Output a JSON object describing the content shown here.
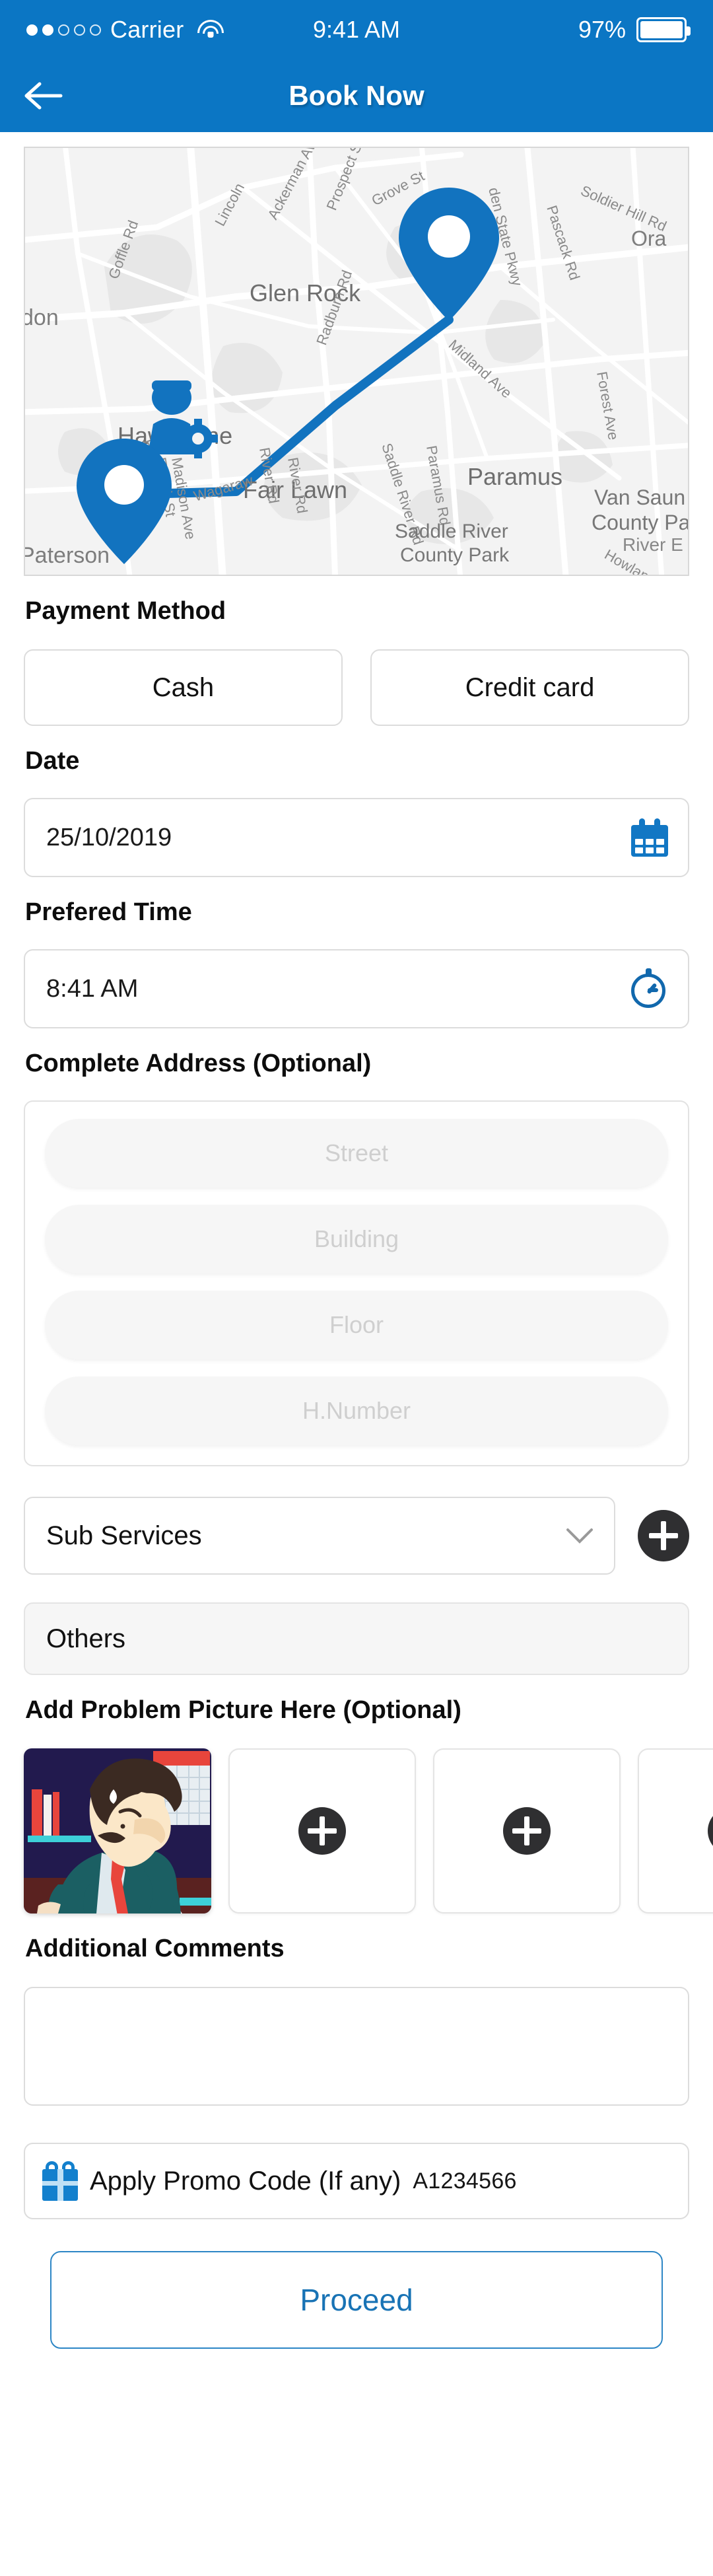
{
  "theme": {
    "brand_blue": "#0b76c4",
    "accent_blue": "#1277c4",
    "proceed_text": "#1873b5",
    "dark_button": "#2f2f31",
    "placeholder_grey": "#cfcfcf"
  },
  "statusbar": {
    "carrier": "Carrier",
    "signal_dots_filled": 2,
    "signal_dots_total": 5,
    "wifi_icon": "wifi-icon",
    "time": "9:41 AM",
    "battery_percent": "97%",
    "battery_icon": "battery-full-icon"
  },
  "header": {
    "back_icon": "arrow-left-icon",
    "title": "Book Now"
  },
  "map": {
    "pin_icon": "map-pin-icon",
    "worker_icon": "worker-gear-icon",
    "route_color": "#1273bf",
    "city_labels": [
      "Glen Rock",
      "Hawthorne",
      "Fair Lawn",
      "Paramus",
      "Paterson",
      "don"
    ],
    "park_labels": [
      "Saddle River County Park",
      "Van Saun County Park"
    ],
    "street_labels": [
      "Goffle Rd",
      "Lincoln",
      "Ackerman Ave",
      "Prospect St",
      "Grove St",
      "Radburn Rd",
      "Midland Ave",
      "Garden State Pkwy",
      "Pascack Rd",
      "Soldier Hill Rd",
      "Forest Ave",
      "Saddle River Rd",
      "Paramus Rd",
      "River Rd",
      "E 16th St",
      "Madison Ave",
      "Wagaraw",
      "Howland Ave",
      "River E",
      "Ora"
    ]
  },
  "payment": {
    "label": "Payment Method",
    "options": [
      {
        "label": "Cash"
      },
      {
        "label": "Credit card"
      }
    ]
  },
  "date": {
    "label": "Date",
    "value": "25/10/2019",
    "icon": "calendar-icon"
  },
  "time": {
    "label": "Prefered Time",
    "value": "8:41 AM",
    "icon": "stopwatch-icon"
  },
  "address": {
    "label": "Complete Address (Optional)",
    "fields": [
      {
        "placeholder": "Street",
        "value": ""
      },
      {
        "placeholder": "Building",
        "value": ""
      },
      {
        "placeholder": "Floor",
        "value": ""
      },
      {
        "placeholder": "H.Number",
        "value": ""
      }
    ]
  },
  "sub_services": {
    "selected": "Sub Services",
    "chevron_icon": "chevron-down-icon",
    "add_icon": "plus-icon"
  },
  "others": {
    "value": "Others"
  },
  "pictures": {
    "label": "Add Problem Picture Here (Optional)",
    "thumbnail_alt": "stressed-man-at-desk",
    "empty_slots": 3,
    "add_icon": "plus-icon"
  },
  "comments": {
    "label": "Additional Comments",
    "value": "",
    "placeholder": ""
  },
  "promo": {
    "icon": "gift-icon",
    "label": "Apply Promo Code (If any)",
    "code": "A1234566"
  },
  "proceed": {
    "label": "Proceed"
  }
}
